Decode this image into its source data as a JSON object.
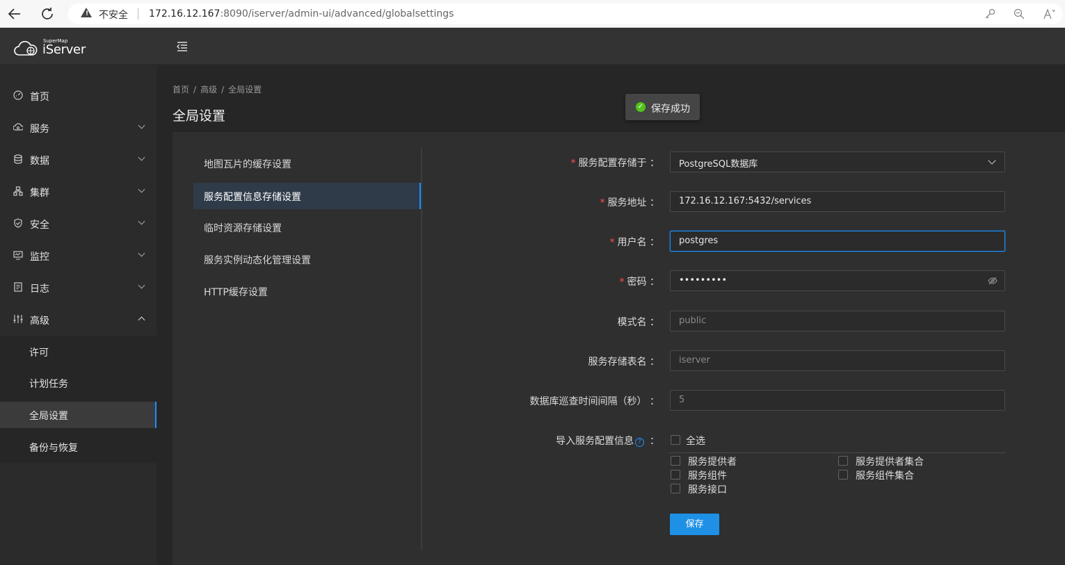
{
  "browser": {
    "security_label": "不安全",
    "url_host": "172.16.12.167",
    "url_rest": ":8090/iserver/admin-ui/advanced/globalsettings"
  },
  "app": {
    "logo_small": "SuperMap",
    "logo_main": "iServer"
  },
  "sidebar": {
    "items": [
      {
        "label": "首页",
        "icon": "dashboard-icon"
      },
      {
        "label": "服务",
        "icon": "cloud-service-icon"
      },
      {
        "label": "数据",
        "icon": "database-icon"
      },
      {
        "label": "集群",
        "icon": "cluster-icon"
      },
      {
        "label": "安全",
        "icon": "shield-icon"
      },
      {
        "label": "监控",
        "icon": "monitor-icon"
      },
      {
        "label": "日志",
        "icon": "log-icon"
      },
      {
        "label": "高级",
        "icon": "sliders-icon"
      }
    ],
    "sub_items": [
      {
        "label": "许可"
      },
      {
        "label": "计划任务"
      },
      {
        "label": "全局设置"
      },
      {
        "label": "备份与恢复"
      }
    ]
  },
  "breadcrumb": [
    "首页",
    "高级",
    "全局设置"
  ],
  "page_title": "全局设置",
  "toast": {
    "label": "保存成功"
  },
  "tabs": [
    {
      "label": "地图瓦片的缓存设置"
    },
    {
      "label": "服务配置信息存储设置"
    },
    {
      "label": "临时资源存储设置"
    },
    {
      "label": "服务实例动态化管理设置"
    },
    {
      "label": "HTTP缓存设置"
    }
  ],
  "form": {
    "storage": {
      "label": "服务配置存储于 ：",
      "value": "PostgreSQL数据库"
    },
    "address": {
      "label": "服务地址 ：",
      "value": "172.16.12.167:5432/services"
    },
    "username": {
      "label": "用户名 ：",
      "value": "postgres"
    },
    "password": {
      "label": "密码 ：",
      "value": "•••••••••"
    },
    "schema": {
      "label": "模式名 ：",
      "placeholder": "public"
    },
    "table": {
      "label": "服务存储表名 ：",
      "placeholder": "iserver"
    },
    "interval": {
      "label": "数据库巡查时间间隔（秒） ：",
      "placeholder": "5"
    },
    "import": {
      "label": "导入服务配置信息",
      "colon": "：",
      "help": "?"
    },
    "select_all": "全选",
    "options": [
      "服务提供者",
      "服务提供者集合",
      "服务组件",
      "服务组件集合",
      "服务接口"
    ],
    "save_label": "保存"
  }
}
